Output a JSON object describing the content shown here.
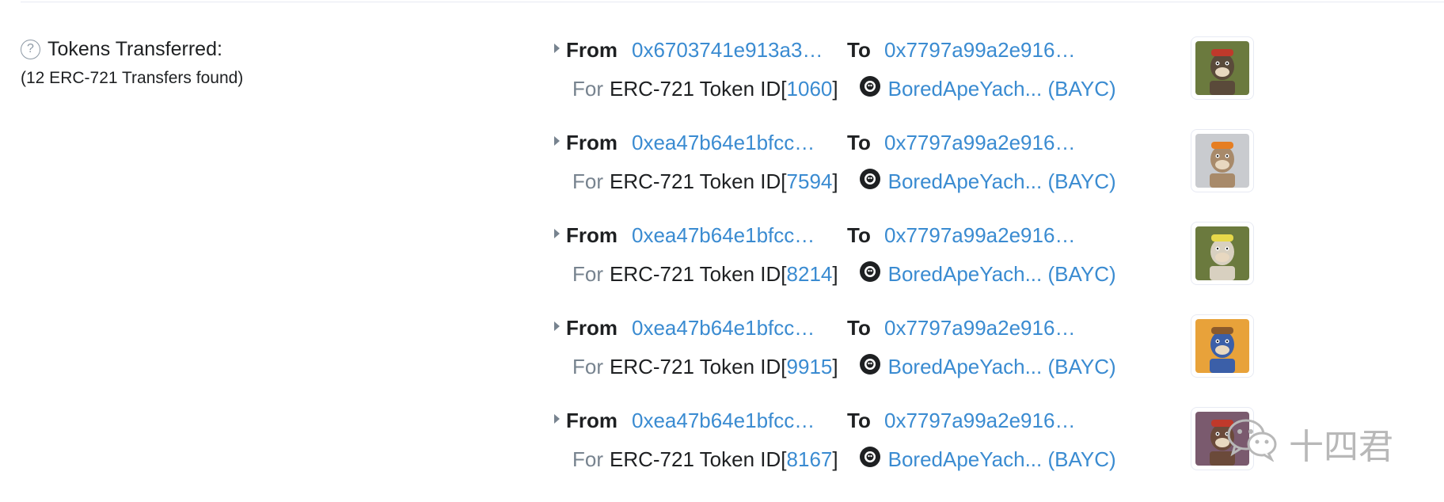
{
  "section": {
    "help_glyph": "?",
    "title": "Tokens Transferred:",
    "subtitle": "(12 ERC-721 Transfers found)"
  },
  "labels": {
    "from": "From",
    "to": "To",
    "for": "For",
    "standard": "ERC-721 Token ID",
    "open_bracket": "[",
    "close_bracket": "]"
  },
  "transfers": [
    {
      "from": "0x6703741e913a3…",
      "to": "0x7797a99a2e916…",
      "token_id": "1060",
      "token_name": "BoredApeYach... (BAYC)",
      "thumb_bg": "#6b7a3e",
      "fur": "#5a4a3a",
      "accent": "#c0392b"
    },
    {
      "from": "0xea47b64e1bfcc…",
      "to": "0x7797a99a2e916…",
      "token_id": "7594",
      "token_name": "BoredApeYach... (BAYC)",
      "thumb_bg": "#c9cbcf",
      "fur": "#a88a6a",
      "accent": "#e67e22"
    },
    {
      "from": "0xea47b64e1bfcc…",
      "to": "0x7797a99a2e916…",
      "token_id": "8214",
      "token_name": "BoredApeYach... (BAYC)",
      "thumb_bg": "#6b7a3e",
      "fur": "#d8d0c0",
      "accent": "#e6d84a"
    },
    {
      "from": "0xea47b64e1bfcc…",
      "to": "0x7797a99a2e916…",
      "token_id": "9915",
      "token_name": "BoredApeYach... (BAYC)",
      "thumb_bg": "#e8a23a",
      "fur": "#3b5fa8",
      "accent": "#8b5a2b"
    },
    {
      "from": "0xea47b64e1bfcc…",
      "to": "0x7797a99a2e916…",
      "token_id": "8167",
      "token_name": "BoredApeYach... (BAYC)",
      "thumb_bg": "#7a5a6e",
      "fur": "#6b4a3a",
      "accent": "#c0392b"
    }
  ],
  "watermark": {
    "text": "十四君",
    "icon": "wechat-icon"
  },
  "colors": {
    "link": "#3a8bd1",
    "muted": "#77838f",
    "text": "#1e2022"
  }
}
